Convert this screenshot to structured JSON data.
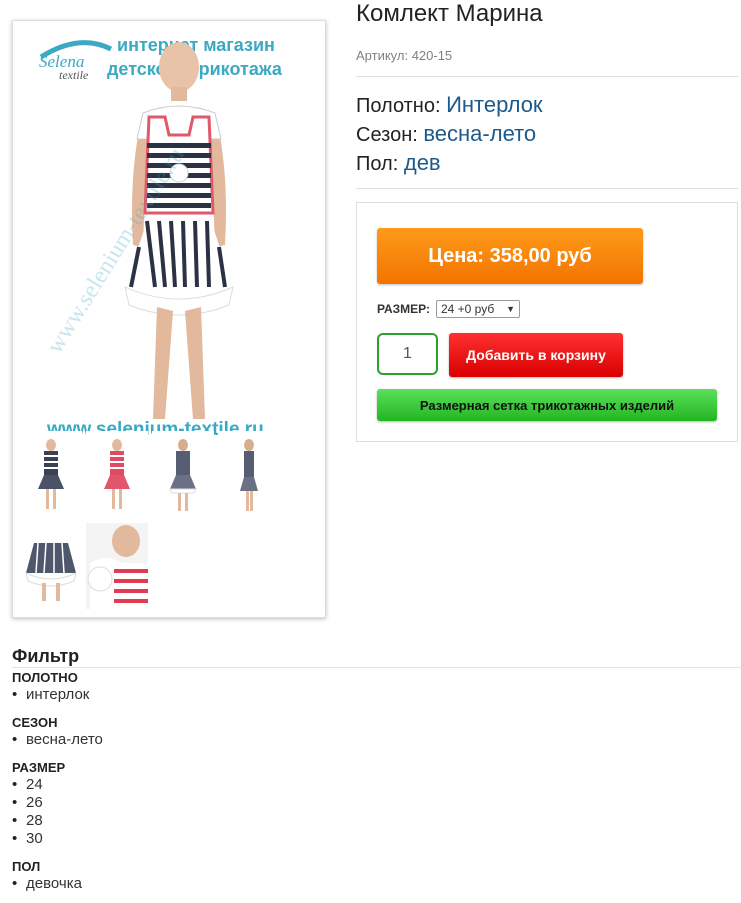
{
  "product": {
    "title": "Комлект Марина",
    "sku": "Артикул: 420-15",
    "properties": [
      {
        "label": "Полотно:",
        "value": "Интерлок"
      },
      {
        "label": "Сезон:",
        "value": "весна-лето"
      },
      {
        "label": "Пол:",
        "value": "дев"
      }
    ]
  },
  "gallery": {
    "watermark_brand_1": "Selena",
    "watermark_brand_2": "textile",
    "banner_line_1": "интернет магазин",
    "banner_line_2": "детского трикотажа",
    "banner_url": "www.selenium-textile.ru",
    "thumbnail_count": 6
  },
  "buybox": {
    "price_label": "Цена: 358,00 руб",
    "size_label": "РАЗМЕР:",
    "size_selected": "24 +0 руб",
    "quantity": "1",
    "add_to_cart": "Добавить в корзину",
    "size_chart": "Размерная сетка трикотажных изделий"
  },
  "filter": {
    "title": "Фильтр",
    "groups": [
      {
        "title": "ПОЛОТНО",
        "items": [
          "интерлок"
        ]
      },
      {
        "title": "СЕЗОН",
        "items": [
          "весна-лето"
        ]
      },
      {
        "title": "РАЗМЕР",
        "items": [
          "24",
          "26",
          "28",
          "30"
        ]
      },
      {
        "title": "ПОЛ",
        "items": [
          "девочка"
        ]
      }
    ]
  },
  "colors": {
    "price_orange": "#f58400",
    "cart_red": "#e81010",
    "size_chart_green": "#3fcc3f",
    "link_blue": "#1d5a8c",
    "banner_teal": "#3ba9c4"
  }
}
